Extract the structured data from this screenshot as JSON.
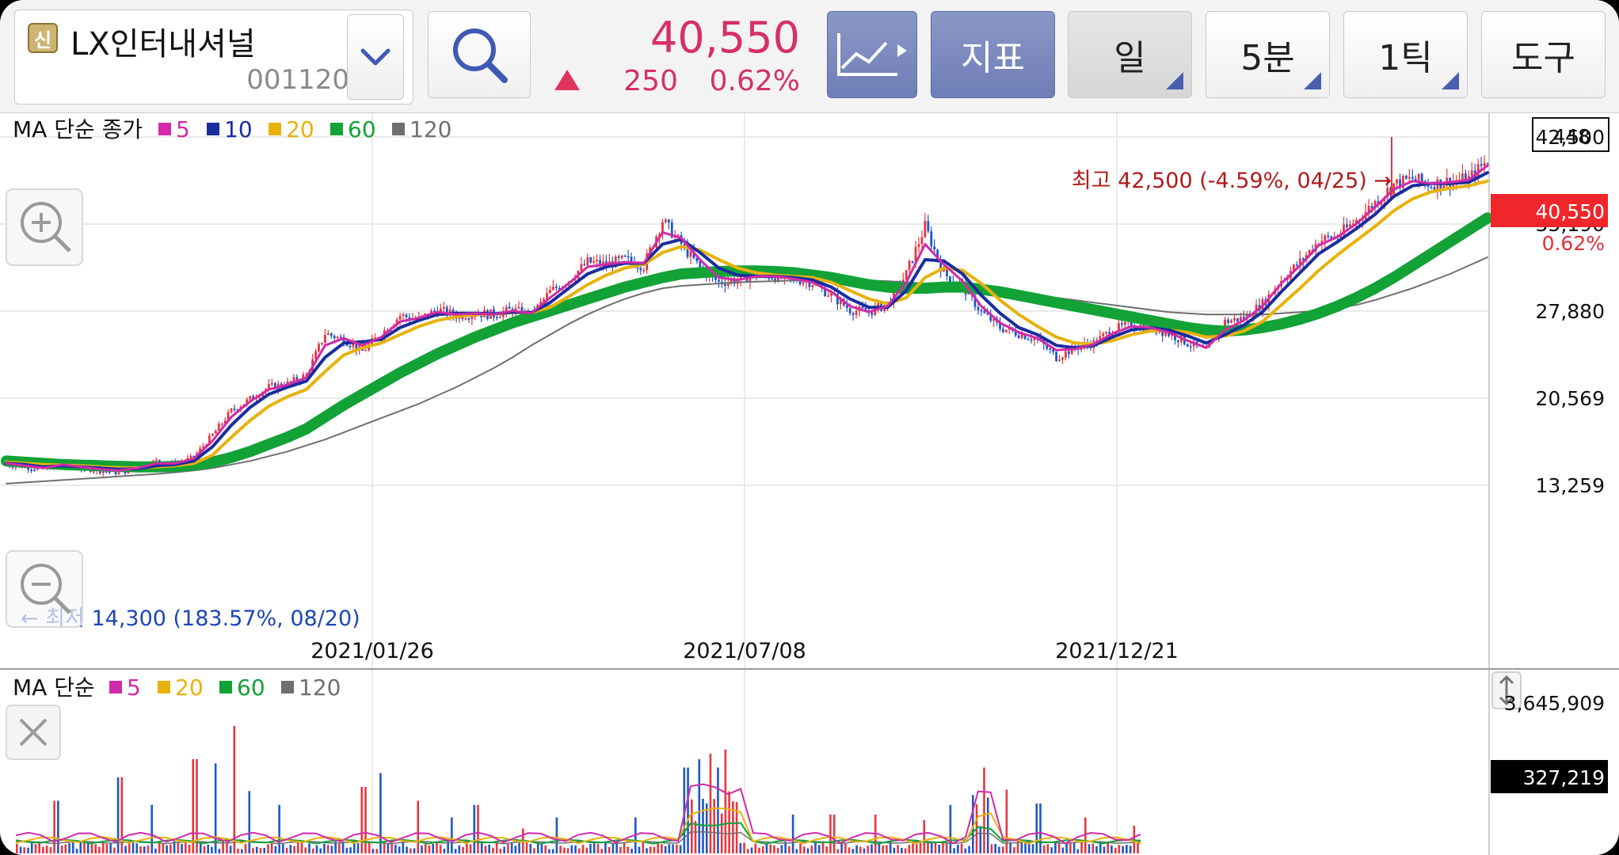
{
  "stock": {
    "badge": "신",
    "name": "LX인터내셔널",
    "code": "001120",
    "price": "40,550",
    "change": "250",
    "change_pct": "0.62%"
  },
  "toolbar": {
    "indicator_label": "지표",
    "period_day": "일",
    "period_minute": "5분",
    "period_tick": "1틱",
    "tools_label": "도구"
  },
  "colors": {
    "up": "#e8363c",
    "down": "#1f56c9",
    "ma5": "#d22aa8",
    "ma10": "#1a2c9e",
    "ma20": "#e8b20c",
    "ma60": "#12a236",
    "ma120": "#6f6f6f"
  },
  "icons": [
    "search-icon",
    "chart-type-icon",
    "chevron-down-icon",
    "zoom-in-icon",
    "zoom-out-icon",
    "close-icon",
    "resize-icon"
  ],
  "price_panel": {
    "legend_title": "MA 단순 종가",
    "legend": [
      {
        "label": "5",
        "color": "#d22aa8"
      },
      {
        "label": "10",
        "color": "#1a2c9e"
      },
      {
        "label": "20",
        "color": "#e8b20c"
      },
      {
        "label": "60",
        "color": "#12a236"
      },
      {
        "label": "120",
        "color": "#6f6f6f"
      }
    ],
    "count_box": "448",
    "y_ticks": [
      "42,500",
      "35,190",
      "27,880",
      "20,569",
      "13,259"
    ],
    "current_price_tag": "40,550",
    "current_pct_tag": "0.62%",
    "high_annotation": "최고 42,500 (-4.59%, 04/25) →",
    "low_annotation": "← 최저 14,300 (183.57%, 08/20)",
    "x_ticks": [
      "2021/01/26",
      "2021/07/08",
      "2021/12/21"
    ]
  },
  "volume_panel": {
    "legend_title": "MA 단순",
    "legend": [
      {
        "label": "5",
        "color": "#d22aa8"
      },
      {
        "label": "20",
        "color": "#e8b20c"
      },
      {
        "label": "60",
        "color": "#12a236"
      },
      {
        "label": "120",
        "color": "#6f6f6f"
      }
    ],
    "max_label": "3,645,909",
    "current_label": "327,219"
  },
  "chart_data": {
    "type": "line",
    "x_ticks": [
      "2021/01/26",
      "2021/07/08",
      "2021/12/21"
    ],
    "ylim": [
      13259,
      42500
    ],
    "y_ticks": [
      42500,
      35190,
      27880,
      20569,
      13259
    ],
    "high": {
      "value": 42500,
      "label": "최고 42,500 (-4.59%, 04/25) →"
    },
    "low": {
      "value": 14300,
      "label": "← 최저 14,300 (183.57%, 08/20)"
    },
    "current": 40550,
    "price_path": [
      15000,
      14800,
      14600,
      15200,
      14700,
      14500,
      14300,
      14700,
      15300,
      15000,
      15600,
      17500,
      19500,
      20500,
      21500,
      21800,
      22500,
      26000,
      25500,
      24500,
      26000,
      27500,
      27200,
      28000,
      27500,
      27700,
      27600,
      28000,
      27500,
      29500,
      30500,
      32000,
      31800,
      32200,
      31700,
      35500,
      33500,
      31500,
      30300,
      30500,
      31000,
      30800,
      30600,
      30300,
      29200,
      28000,
      27800,
      28500,
      31000,
      35000,
      31000,
      30000,
      27800,
      26500,
      26000,
      25500,
      24000,
      24800,
      25200,
      26300,
      26800,
      26500,
      26000,
      25200,
      24500,
      27000,
      27300,
      28500,
      30500,
      32000,
      33800,
      34200,
      35500,
      37000,
      38500,
      39000,
      38500,
      38800,
      39000,
      40550
    ],
    "series": [
      {
        "name": "5",
        "values": [
          15100,
          14900,
          14700,
          15000,
          14800,
          14600,
          14500,
          14700,
          15100,
          15100,
          15500,
          17000,
          19000,
          20300,
          21300,
          21700,
          22300,
          25000,
          25600,
          25000,
          25700,
          27000,
          27300,
          27800,
          27600,
          27700,
          27600,
          27900,
          27700,
          29000,
          30200,
          31600,
          31800,
          32000,
          31900,
          34500,
          34000,
          32200,
          30700,
          30500,
          30800,
          30800,
          30600,
          30300,
          29500,
          28300,
          27800,
          28300,
          30300,
          33500,
          31800,
          30400,
          28300,
          26900,
          26100,
          25600,
          24600,
          24700,
          25100,
          26000,
          26600,
          26500,
          26100,
          25400,
          24800,
          26300,
          27100,
          28300,
          30200,
          31700,
          33400,
          34100,
          35200,
          36600,
          38100,
          38800,
          38600,
          38700,
          38900,
          40100
        ]
      },
      {
        "name": "10",
        "values": [
          15100,
          15000,
          14800,
          14900,
          14800,
          14700,
          14600,
          14650,
          14900,
          15000,
          15300,
          16500,
          18300,
          19800,
          20900,
          21500,
          22000,
          24000,
          25200,
          25300,
          25500,
          26500,
          27100,
          27600,
          27700,
          27700,
          27650,
          27800,
          27750,
          28600,
          29800,
          31000,
          31600,
          31900,
          31900,
          33500,
          33900,
          32800,
          31500,
          30900,
          30800,
          30800,
          30700,
          30500,
          29900,
          28900,
          28200,
          28200,
          29600,
          32200,
          32100,
          31000,
          29200,
          27700,
          26500,
          25900,
          25000,
          24800,
          25000,
          25700,
          26300,
          26500,
          26300,
          25800,
          25200,
          25900,
          26700,
          27800,
          29500,
          31100,
          32700,
          33700,
          34800,
          36000,
          37500,
          38400,
          38600,
          38600,
          38700,
          39500
        ]
      },
      {
        "name": "20",
        "values": [
          15200,
          15100,
          15000,
          14950,
          14900,
          14800,
          14750,
          14700,
          14800,
          14900,
          15100,
          15800,
          17300,
          18700,
          19900,
          20700,
          21300,
          22800,
          24200,
          24800,
          25200,
          25900,
          26600,
          27100,
          27400,
          27600,
          27650,
          27750,
          27750,
          28200,
          29100,
          30100,
          30900,
          31500,
          31800,
          32800,
          33300,
          33000,
          32200,
          31500,
          31100,
          30900,
          30800,
          30700,
          30300,
          29600,
          28900,
          28500,
          29000,
          30700,
          31500,
          31300,
          30200,
          28800,
          27600,
          26600,
          25700,
          25200,
          25100,
          25400,
          25900,
          26200,
          26300,
          26100,
          25700,
          25800,
          26200,
          27000,
          28400,
          29800,
          31300,
          32600,
          33800,
          35000,
          36300,
          37300,
          37900,
          38200,
          38400,
          38800
        ]
      },
      {
        "name": "60",
        "values": [
          15300,
          15200,
          15100,
          15000,
          14950,
          14900,
          14850,
          14800,
          14800,
          14850,
          14950,
          15200,
          15600,
          16100,
          16700,
          17300,
          18000,
          19000,
          20000,
          20900,
          21800,
          22700,
          23500,
          24300,
          25000,
          25700,
          26300,
          26900,
          27400,
          27900,
          28400,
          28900,
          29400,
          29900,
          30300,
          30700,
          31000,
          31100,
          31200,
          31250,
          31250,
          31200,
          31100,
          30900,
          30700,
          30400,
          30100,
          29900,
          29800,
          29800,
          29900,
          29900,
          29700,
          29500,
          29200,
          28900,
          28600,
          28300,
          28000,
          27700,
          27400,
          27100,
          26800,
          26500,
          26300,
          26200,
          26300,
          26500,
          26800,
          27200,
          27700,
          28300,
          29000,
          29800,
          30700,
          31700,
          32700,
          33700,
          34700,
          35700
        ]
      },
      {
        "name": "120",
        "values": [
          13400,
          13500,
          13600,
          13700,
          13800,
          13900,
          14000,
          14100,
          14200,
          14350,
          14500,
          14700,
          15000,
          15300,
          15700,
          16100,
          16600,
          17100,
          17700,
          18300,
          18900,
          19500,
          20100,
          20800,
          21500,
          22300,
          23100,
          24000,
          25000,
          25900,
          26800,
          27600,
          28300,
          28900,
          29400,
          29800,
          30000,
          30100,
          30200,
          30300,
          30350,
          30400,
          30450,
          30500,
          30500,
          30500,
          30450,
          30400,
          30300,
          30200,
          30100,
          30000,
          29800,
          29600,
          29400,
          29200,
          29000,
          28800,
          28600,
          28400,
          28200,
          28000,
          27800,
          27700,
          27600,
          27600,
          27600,
          27600,
          27700,
          27800,
          27900,
          28100,
          28400,
          28800,
          29300,
          29800,
          30400,
          31000,
          31700,
          32400
        ]
      }
    ]
  }
}
